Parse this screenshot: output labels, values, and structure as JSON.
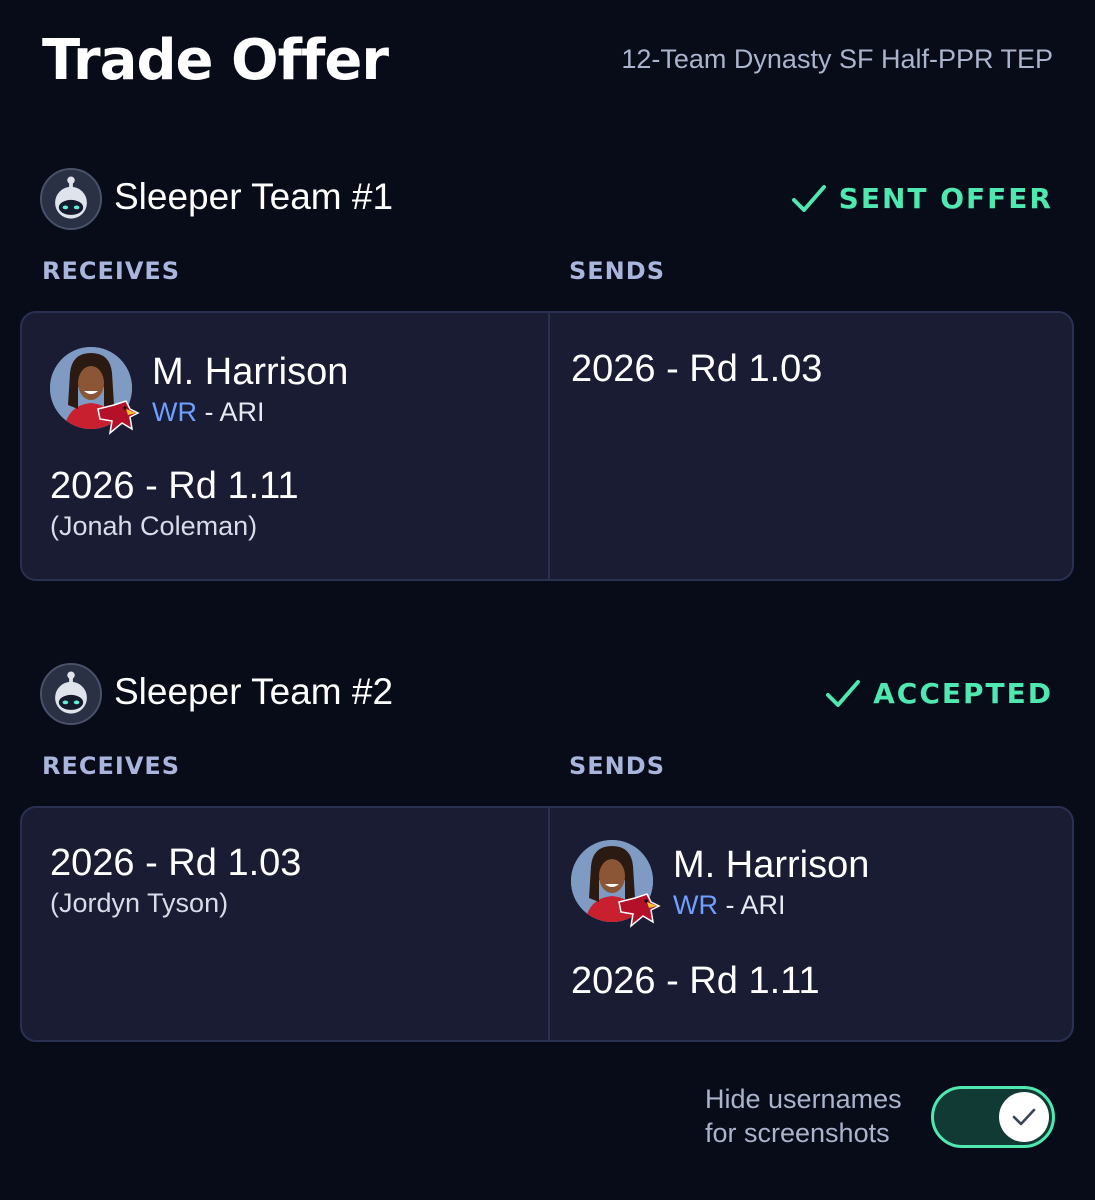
{
  "header": {
    "title": "Trade Offer",
    "league": "12-Team Dynasty SF Half-PPR TEP"
  },
  "colors": {
    "background": "#080b18",
    "card": "#191c32",
    "accent_green": "#4fe8b0",
    "position_blue": "#6fa0ff",
    "label": "#a9b5dc"
  },
  "teams": [
    {
      "name": "Sleeper Team #1",
      "avatar_icon": "sleeper-mascot-icon",
      "status_icon": "checkmark-icon",
      "status": "SENT OFFER",
      "receives_label": "RECEIVES",
      "sends_label": "SENDS",
      "receives": {
        "player": {
          "name": "M. Harrison",
          "position": "WR",
          "separator": "-",
          "team": "ARI",
          "team_logo": "cardinals-logo-icon"
        },
        "pick": {
          "label": "2026 - Rd 1.11",
          "note": "(Jonah Coleman)"
        }
      },
      "sends": {
        "pick": {
          "label": "2026 - Rd 1.03"
        }
      }
    },
    {
      "name": "Sleeper Team #2",
      "avatar_icon": "sleeper-mascot-icon",
      "status_icon": "checkmark-icon",
      "status": "ACCEPTED",
      "receives_label": "RECEIVES",
      "sends_label": "SENDS",
      "receives": {
        "pick": {
          "label": "2026 - Rd 1.03",
          "note": "(Jordyn Tyson)"
        }
      },
      "sends": {
        "player": {
          "name": "M. Harrison",
          "position": "WR",
          "separator": "-",
          "team": "ARI",
          "team_logo": "cardinals-logo-icon"
        },
        "pick": {
          "label": "2026 - Rd 1.11"
        }
      }
    }
  ],
  "footer": {
    "toggle_label_line1": "Hide usernames",
    "toggle_label_line2": "for screenshots",
    "toggle_on": true
  }
}
